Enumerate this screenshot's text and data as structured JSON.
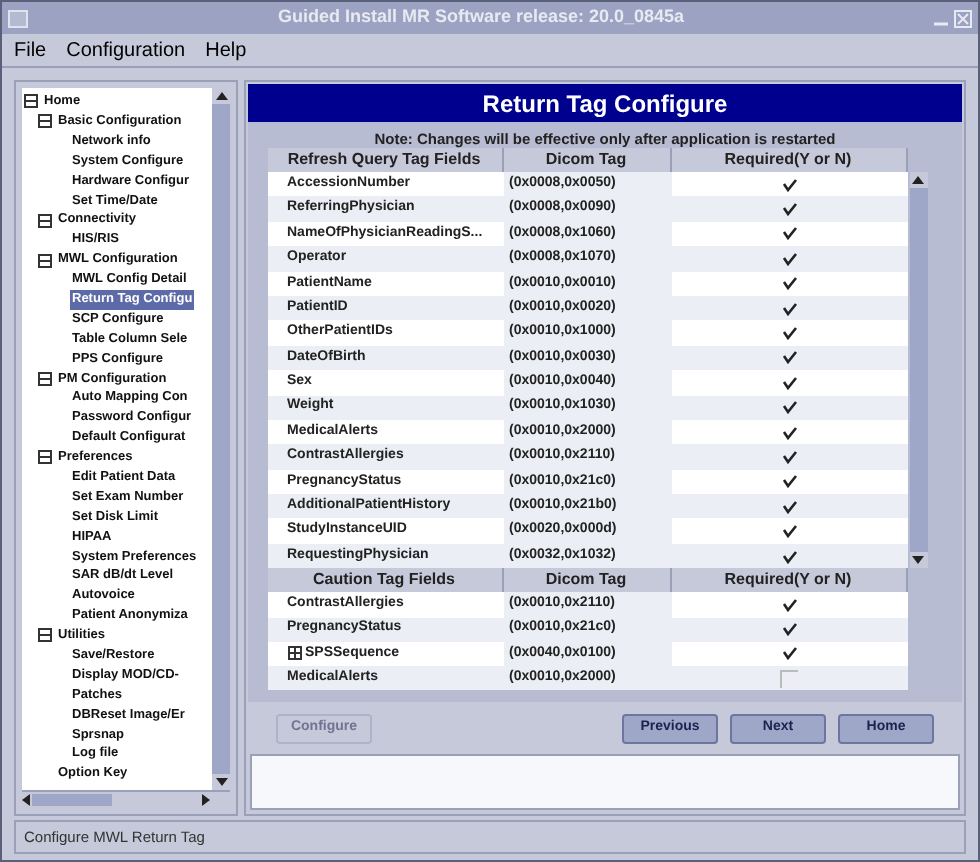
{
  "window": {
    "title": "Guided Install  MR Software release: 20.0_0845a"
  },
  "menu": [
    "File",
    "Configuration",
    "Help"
  ],
  "tree": [
    {
      "label": "Home",
      "expanded": true,
      "selected": false,
      "children": [
        {
          "label": "Basic Configuration",
          "expanded": true,
          "selected": false,
          "children": [
            {
              "label": "Network info",
              "selected": false
            },
            {
              "label": "System Configure",
              "selected": false
            },
            {
              "label": "Hardware Configur",
              "selected": false
            },
            {
              "label": "Set Time/Date",
              "selected": false
            }
          ]
        },
        {
          "label": "Connectivity",
          "expanded": true,
          "selected": false,
          "children": [
            {
              "label": "HIS/RIS",
              "selected": false
            }
          ]
        },
        {
          "label": "MWL Configuration",
          "expanded": true,
          "selected": false,
          "children": [
            {
              "label": "MWL Config Detail",
              "selected": false
            },
            {
              "label": "Return Tag Configu",
              "selected": true
            },
            {
              "label": "SCP Configure",
              "selected": false
            },
            {
              "label": "Table Column Sele",
              "selected": false
            },
            {
              "label": "PPS Configure",
              "selected": false
            }
          ]
        },
        {
          "label": "PM Configuration",
          "expanded": true,
          "selected": false,
          "children": [
            {
              "label": "Auto Mapping Con",
              "selected": false
            },
            {
              "label": "Password Configur",
              "selected": false
            },
            {
              "label": "Default Configurat",
              "selected": false
            }
          ]
        },
        {
          "label": "Preferences",
          "expanded": true,
          "selected": false,
          "children": [
            {
              "label": "Edit Patient Data",
              "selected": false
            },
            {
              "label": "Set Exam Number",
              "selected": false
            },
            {
              "label": "Set Disk Limit",
              "selected": false
            },
            {
              "label": "HIPAA",
              "selected": false
            },
            {
              "label": "System Preferences",
              "selected": false
            },
            {
              "label": "SAR dB/dt Level",
              "selected": false
            },
            {
              "label": "Autovoice",
              "selected": false
            },
            {
              "label": "Patient Anonymiza",
              "selected": false
            }
          ]
        },
        {
          "label": "Utilities",
          "expanded": true,
          "selected": false,
          "children": [
            {
              "label": "Save/Restore",
              "selected": false
            },
            {
              "label": "Display MOD/CD-",
              "selected": false
            },
            {
              "label": "Patches",
              "selected": false
            },
            {
              "label": "DBReset Image/Er",
              "selected": false
            },
            {
              "label": "Sprsnap",
              "selected": false
            },
            {
              "label": "Log file",
              "selected": false
            }
          ]
        },
        {
          "label": "Option Key",
          "selected": false
        }
      ]
    }
  ],
  "header": {
    "title": "Return Tag Configure"
  },
  "note": "Note: Changes will be effective only after application is restarted",
  "query_table": {
    "columns": [
      "Refresh Query Tag Fields",
      "Dicom Tag",
      "Required(Y or N)"
    ],
    "rows": [
      {
        "field": "AccessionNumber",
        "tag": "(0x0008,0x0050)",
        "checked": true
      },
      {
        "field": "ReferringPhysician",
        "tag": "(0x0008,0x0090)",
        "checked": true
      },
      {
        "field": "NameOfPhysicianReadingS...",
        "tag": "(0x0008,0x1060)",
        "checked": true
      },
      {
        "field": "Operator",
        "tag": "(0x0008,0x1070)",
        "checked": true
      },
      {
        "field": "PatientName",
        "tag": "(0x0010,0x0010)",
        "checked": true
      },
      {
        "field": "PatientID",
        "tag": "(0x0010,0x0020)",
        "checked": true
      },
      {
        "field": "OtherPatientIDs",
        "tag": "(0x0010,0x1000)",
        "checked": true
      },
      {
        "field": "DateOfBirth",
        "tag": "(0x0010,0x0030)",
        "checked": true
      },
      {
        "field": "Sex",
        "tag": "(0x0010,0x0040)",
        "checked": true
      },
      {
        "field": "Weight",
        "tag": "(0x0010,0x1030)",
        "checked": true
      },
      {
        "field": "MedicalAlerts",
        "tag": "(0x0010,0x2000)",
        "checked": true
      },
      {
        "field": "ContrastAllergies",
        "tag": "(0x0010,0x2110)",
        "checked": true
      },
      {
        "field": "PregnancyStatus",
        "tag": "(0x0010,0x21c0)",
        "checked": true
      },
      {
        "field": "AdditionalPatientHistory",
        "tag": "(0x0010,0x21b0)",
        "checked": true
      },
      {
        "field": "StudyInstanceUID",
        "tag": "(0x0020,0x000d)",
        "checked": true
      },
      {
        "field": "RequestingPhysician",
        "tag": "(0x0032,0x1032)",
        "checked": true
      }
    ]
  },
  "caution_table": {
    "columns": [
      "Caution Tag Fields",
      "Dicom Tag",
      "Required(Y or N)"
    ],
    "rows": [
      {
        "kind": "field",
        "field": "ContrastAllergies",
        "tag": "(0x0010,0x2110)",
        "checked": true
      },
      {
        "kind": "field",
        "field": "PregnancyStatus",
        "tag": "(0x0010,0x21c0)",
        "checked": true
      },
      {
        "kind": "group",
        "field": "SPSSequence",
        "tag": "(0x0040,0x0100)",
        "checked": true
      },
      {
        "kind": "field",
        "field": "MedicalAlerts",
        "tag": "(0x0010,0x2000)",
        "checked": false
      }
    ]
  },
  "buttons": [
    {
      "label": "Configure",
      "disabled": true
    },
    {
      "label": "Previous",
      "disabled": false
    },
    {
      "label": "Next",
      "disabled": false
    },
    {
      "label": "Home",
      "disabled": false
    }
  ],
  "status_bar": "Configure MWL Return Tag"
}
